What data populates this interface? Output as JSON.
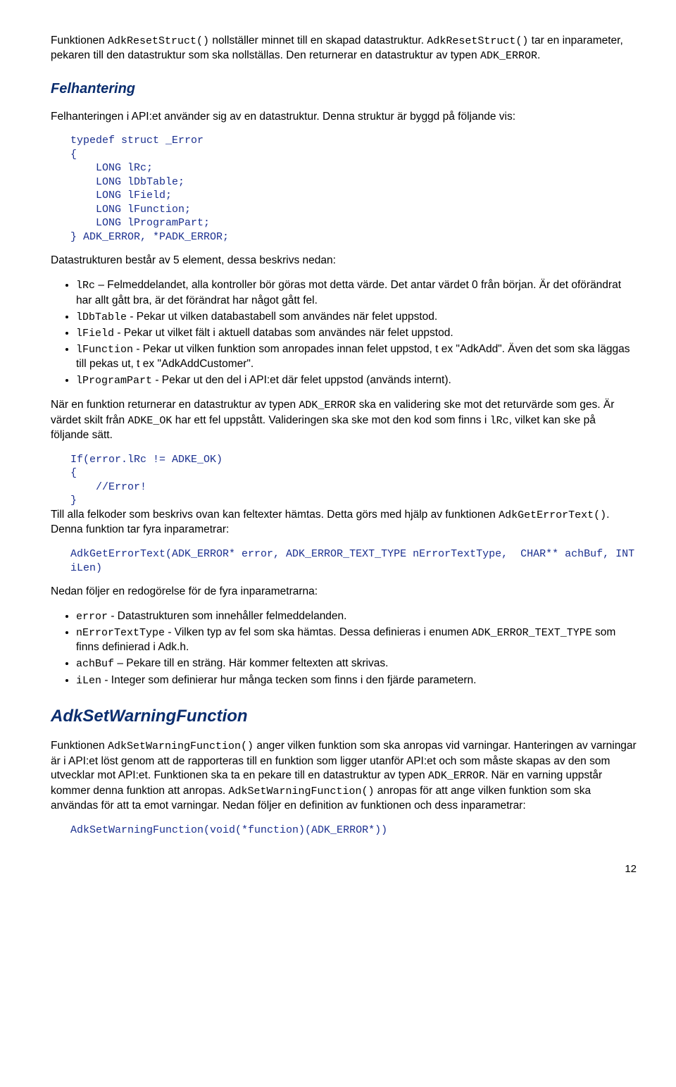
{
  "p1_a": "Funktionen ",
  "p1_b": "AdkResetStruct()",
  "p1_c": " nollställer minnet till en skapad datastruktur. ",
  "p1_d": "AdkResetStruct()",
  "p1_e": " tar en inparameter, pekaren till den datastruktur som ska nollställas. Den returnerar en datastruktur av typen ",
  "p1_f": "ADK_ERROR",
  "p1_g": ".",
  "h_felhantering": "Felhantering",
  "p2": "Felhanteringen i API:et använder sig av en datastruktur. Denna struktur är byggd på följande vis:",
  "code1": "typedef struct _Error\n{\n    LONG lRc;\n    LONG lDbTable;\n    LONG lField;\n    LONG lFunction;\n    LONG lProgramPart;\n} ADK_ERROR, *PADK_ERROR;",
  "p3": "Datastrukturen består av 5 element, dessa beskrivs nedan:",
  "li1_a": "lRc",
  "li1_b": " – Felmeddelandet, alla kontroller bör göras mot detta värde. Det antar värdet 0 från början. Är det oförändrat har allt gått bra, är det förändrat har något gått fel.",
  "li2_a": "lDbTable",
  "li2_b": " - Pekar ut vilken databastabell som användes när felet uppstod.",
  "li3_a": "lField",
  "li3_b": " - Pekar ut vilket fält i aktuell databas som användes när felet uppstod.",
  "li4_a": "lFunction",
  "li4_b": " - Pekar ut vilken funktion som anropades innan felet uppstod, t ex \"AdkAdd\". Även det som ska läggas till pekas ut, t ex \"AdkAddCustomer\".",
  "li5_a": "lProgramPart",
  "li5_b": " - Pekar ut den del i API:et där felet uppstod (används internt).",
  "p4_a": "När en funktion returnerar en datastruktur av typen ",
  "p4_b": "ADK_ERROR",
  "p4_c": " ska en validering ske mot det returvärde som ges. Är värdet skilt från ",
  "p4_d": "ADKE_OK",
  "p4_e": " har ett fel uppstått. Valideringen ska ske mot den kod som finns i ",
  "p4_f": "lRc",
  "p4_g": ", vilket kan ske på följande sätt.",
  "code2": "If(error.lRc != ADKE_OK)\n{\n    //Error!\n}",
  "p5_a": "Till alla felkoder som beskrivs ovan kan feltexter hämtas. Detta görs med hjälp av funktionen ",
  "p5_b": "AdkGetErrorText()",
  "p5_c": ". Denna funktion tar fyra inparametrar:",
  "code3": "AdkGetErrorText(ADK_ERROR* error, ADK_ERROR_TEXT_TYPE nErrorTextType,  CHAR** achBuf, INT\niLen)",
  "p6": "Nedan följer en redogörelse för de fyra inparametrarna:",
  "li6_a": "error",
  "li6_b": " - Datastrukturen som innehåller felmeddelanden.",
  "li7_a": "nErrorTextType",
  "li7_b": " - Vilken typ av fel som ska hämtas. Dessa definieras i enumen ",
  "li7_c": "ADK_ERROR_TEXT_TYPE",
  "li7_d": " som finns definierad i Adk.h.",
  "li8_a": "achBuf",
  "li8_b": " – Pekare till en sträng. Här kommer feltexten att skrivas.",
  "li9_a": "iLen",
  "li9_b": " - Integer som definierar hur många tecken som finns i den fjärde parametern.",
  "h_adkset": "AdkSetWarningFunction",
  "p7_a": "Funktionen ",
  "p7_b": "AdkSetWarningFunction()",
  "p7_c": " anger vilken funktion som ska anropas vid varningar. Hanteringen av varningar är i API:et löst genom att de rapporteras till en funktion som ligger utanför API:et och som måste skapas av den som utvecklar mot API:et. Funktionen ska ta en pekare till en datastruktur av typen ",
  "p7_d": "ADK_ERROR",
  "p7_e": ". När en varning uppstår kommer denna funktion att anropas. ",
  "p7_f": "AdkSetWarningFunction()",
  "p7_g": " anropas för att ange vilken funktion som ska användas för att ta emot varningar. Nedan följer en definition av funktionen och dess inparametrar:",
  "code4": "AdkSetWarningFunction(void(*function)(ADK_ERROR*))",
  "pagenum": "12"
}
